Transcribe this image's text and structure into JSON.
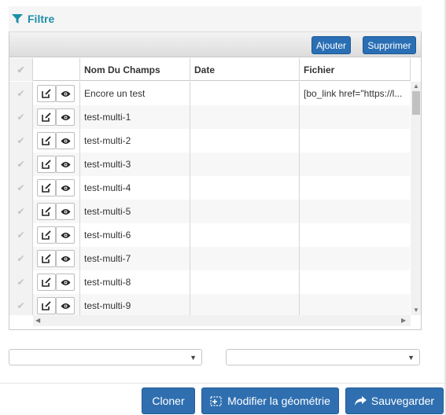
{
  "panel": {
    "title": "Filtre",
    "icon": "filter-icon"
  },
  "toolbar": {
    "add_label": "Ajouter",
    "delete_label": "Supprimer"
  },
  "columns": {
    "name": "Nom Du Champs",
    "date": "Date",
    "file": "Fichier"
  },
  "rows": [
    {
      "name": "Encore un test",
      "date": "",
      "file": "[bo_link href=\"https://l..."
    },
    {
      "name": "test-multi-1",
      "date": "",
      "file": ""
    },
    {
      "name": "test-multi-2",
      "date": "",
      "file": ""
    },
    {
      "name": "test-multi-3",
      "date": "",
      "file": ""
    },
    {
      "name": "test-multi-4",
      "date": "",
      "file": ""
    },
    {
      "name": "test-multi-5",
      "date": "",
      "file": ""
    },
    {
      "name": "test-multi-6",
      "date": "",
      "file": ""
    },
    {
      "name": "test-multi-7",
      "date": "",
      "file": ""
    },
    {
      "name": "test-multi-8",
      "date": "",
      "file": ""
    },
    {
      "name": "test-multi-9",
      "date": "",
      "file": ""
    }
  ],
  "selects": {
    "left_value": "",
    "right_value": ""
  },
  "actions": {
    "clone_label": "Cloner",
    "edit_geometry_label": "Modifier la géométrie",
    "save_label": "Sauvegarder"
  },
  "colors": {
    "accent": "#1d8fa8",
    "primary_button": "#2f6fb0"
  }
}
